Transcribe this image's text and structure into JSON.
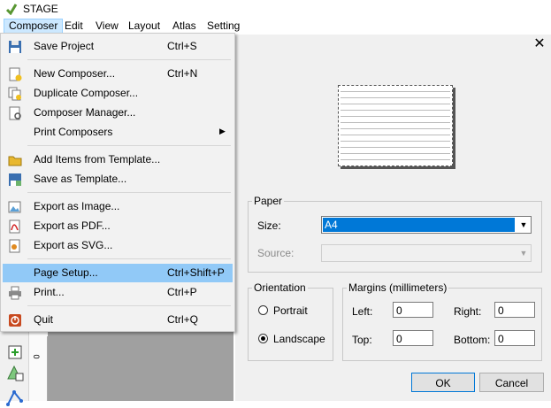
{
  "app": {
    "title": "STAGE"
  },
  "menubar": {
    "items": [
      "Composer",
      "Edit",
      "View",
      "Layout",
      "Atlas",
      "Setting"
    ]
  },
  "composer_menu": {
    "items": [
      {
        "label": "Save Project",
        "shortcut": "Ctrl+S",
        "icon": "save-icon"
      },
      {
        "label": "New Composer...",
        "shortcut": "Ctrl+N",
        "icon": "new-composer-icon"
      },
      {
        "label": "Duplicate Composer...",
        "shortcut": "",
        "icon": "duplicate-composer-icon"
      },
      {
        "label": "Composer Manager...",
        "shortcut": "",
        "icon": "composer-manager-icon"
      },
      {
        "label": "Print Composers",
        "shortcut": "",
        "icon": "",
        "submenu": true
      },
      {
        "label": "Add Items from Template...",
        "shortcut": "",
        "icon": "folder-icon"
      },
      {
        "label": "Save as Template...",
        "shortcut": "",
        "icon": "save-template-icon"
      },
      {
        "label": "Export as Image...",
        "shortcut": "",
        "icon": "export-image-icon"
      },
      {
        "label": "Export as PDF...",
        "shortcut": "",
        "icon": "export-pdf-icon"
      },
      {
        "label": "Export as SVG...",
        "shortcut": "",
        "icon": "export-svg-icon"
      },
      {
        "label": "Page Setup...",
        "shortcut": "Ctrl+Shift+P",
        "icon": "",
        "highlighted": true
      },
      {
        "label": "Print...",
        "shortcut": "Ctrl+P",
        "icon": "printer-icon"
      },
      {
        "label": "Quit",
        "shortcut": "Ctrl+Q",
        "icon": "quit-icon"
      }
    ],
    "submenu_arrow": "▶"
  },
  "page_setup": {
    "close_glyph": "✕",
    "paper": {
      "legend": "Paper",
      "size_label": "Size:",
      "size_value": "A4",
      "source_label": "Source:",
      "source_value": ""
    },
    "orientation": {
      "legend": "Orientation",
      "portrait": "Portrait",
      "landscape": "Landscape",
      "selected": "Landscape"
    },
    "margins": {
      "legend": "Margins (millimeters)",
      "left_label": "Left:",
      "left": "0",
      "right_label": "Right:",
      "right": "0",
      "top_label": "Top:",
      "top": "0",
      "bottom_label": "Bottom:",
      "bottom": "0"
    },
    "ok_label": "OK",
    "cancel_label": "Cancel"
  },
  "ruler": {
    "tick": "0"
  },
  "colors": {
    "highlight": "#91c9f7",
    "selection": "#0078d7"
  }
}
